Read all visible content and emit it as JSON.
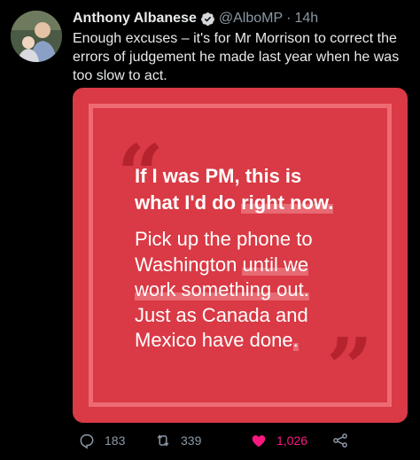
{
  "author": {
    "name": "Anthony Albanese",
    "handle": "@AlboMP",
    "separator": "·",
    "time": "14h"
  },
  "tweet": {
    "text": "Enough excuses – it's for Mr Morrison to correct the errors of judgement he made last year when he was too slow to act."
  },
  "card": {
    "headline_1": "If I was PM, this is",
    "headline_2a": "what I'd do ",
    "headline_2b": "right now.",
    "line_1": "Pick up the phone to",
    "line_2a": "Washington ",
    "line_2b": "until we",
    "line_3": "work something out.",
    "line_4": "Just as Canada and",
    "line_5a": "Mexico have done",
    "line_5b": ".",
    "quote_open": "“",
    "quote_close": "”",
    "bg_color": "#d93a45"
  },
  "actions": {
    "replies": "183",
    "retweets": "339",
    "likes": "1,026",
    "like_color": "#f91880"
  },
  "icons": {
    "verified": "verified-badge-icon",
    "reply": "reply-icon",
    "retweet": "retweet-icon",
    "like": "heart-icon",
    "share": "share-icon"
  }
}
